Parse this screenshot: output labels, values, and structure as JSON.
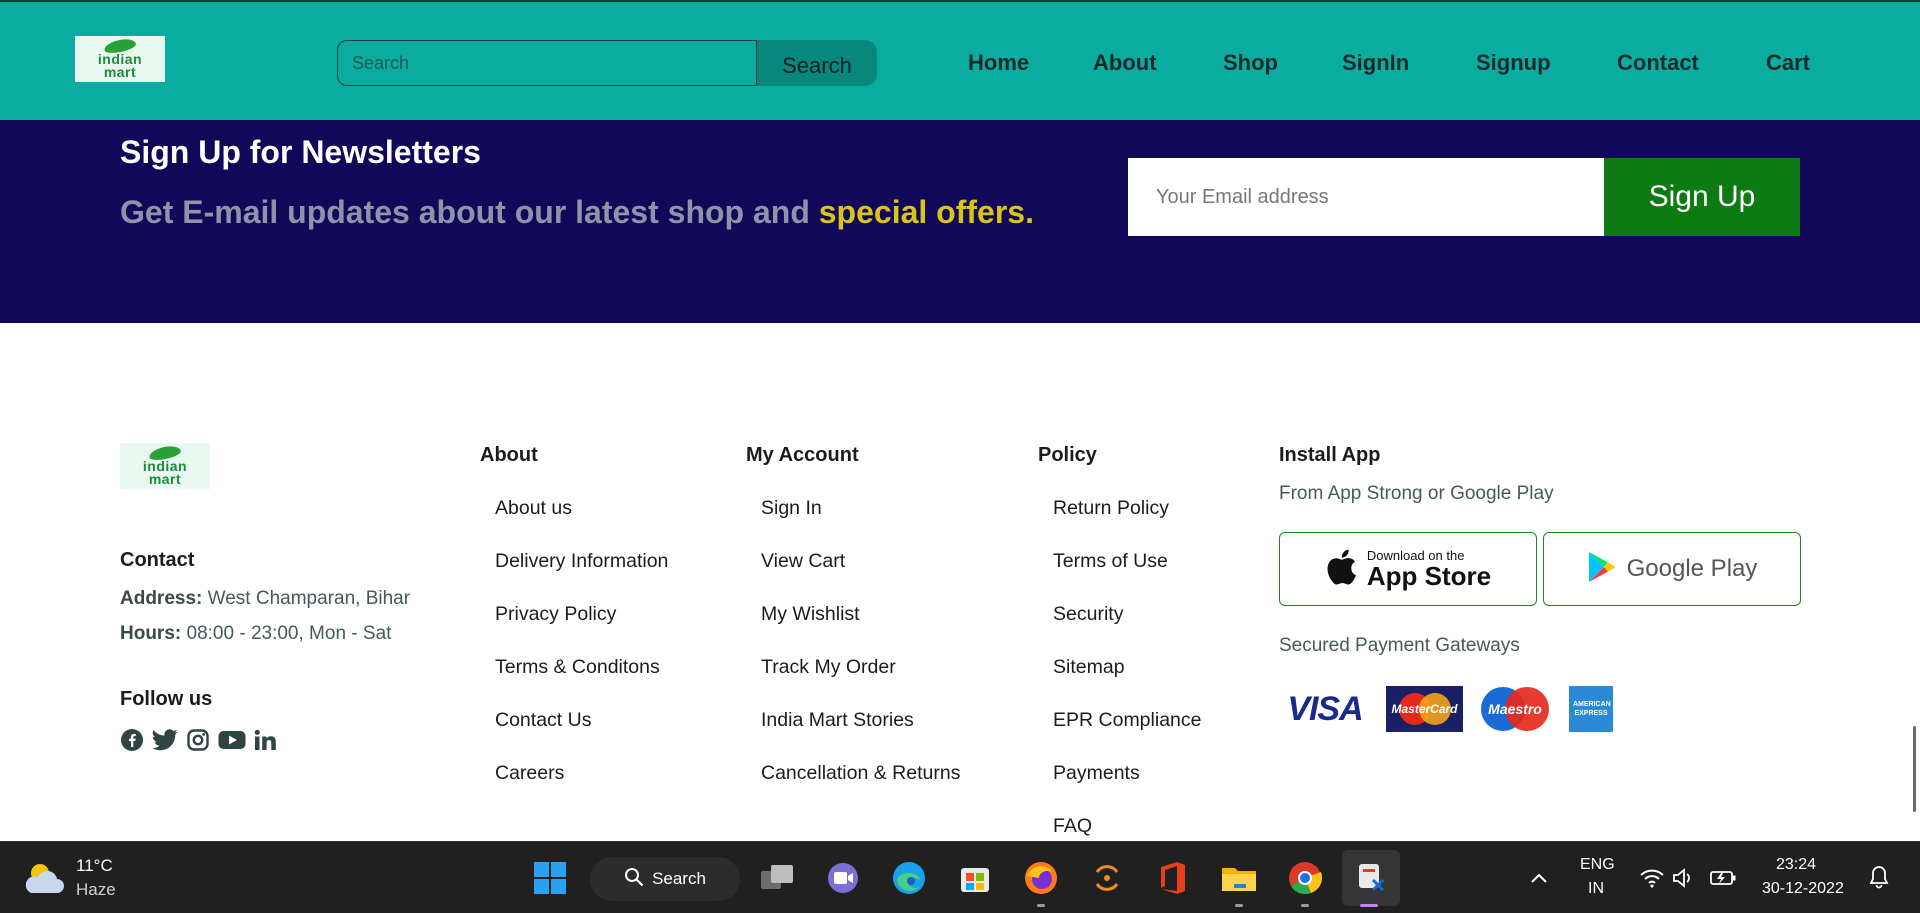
{
  "header": {
    "logo_lines": [
      "indian",
      "mart"
    ],
    "search_placeholder": "Search",
    "search_button": "Search",
    "nav": [
      "Home",
      "About",
      "Shop",
      "SignIn",
      "Signup",
      "Contact",
      "Cart"
    ]
  },
  "newsletter": {
    "title": "Sign Up for Newsletters",
    "subtitle_plain": "Get E-mail updates about our latest shop and",
    "subtitle_highlight": "special offers.",
    "email_placeholder": "Your Email address",
    "button": "Sign Up"
  },
  "footer": {
    "logo_lines": [
      "indian",
      "mart"
    ],
    "contact": {
      "heading": "Contact",
      "address_label": "Address:",
      "address_value": "West Champaran, Bihar",
      "hours_label": "Hours:",
      "hours_value": "08:00 - 23:00, Mon - Sat"
    },
    "follow": {
      "heading": "Follow us",
      "icons": [
        "facebook-icon",
        "twitter-icon",
        "instagram-icon",
        "youtube-icon",
        "linkedin-icon"
      ]
    },
    "about": {
      "heading": "About",
      "links": [
        "About us",
        "Delivery Information",
        "Privacy Policy",
        "Terms & Conditons",
        "Contact Us",
        "Careers"
      ]
    },
    "account": {
      "heading": "My Account",
      "links": [
        "Sign In",
        "View Cart",
        "My Wishlist",
        "Track My Order",
        "India Mart Stories",
        "Cancellation & Returns"
      ]
    },
    "policy": {
      "heading": "Policy",
      "links": [
        "Return Policy",
        "Terms of Use",
        "Security",
        "Sitemap",
        "EPR Compliance",
        "Payments",
        "FAQ"
      ]
    },
    "install": {
      "heading": "Install App",
      "subtitle": "From App Strong or Google Play",
      "appstore_small": "Download on the",
      "appstore_big": "App Store",
      "googleplay": "Google Play",
      "payments_label": "Secured Payment Gateways",
      "payment_methods": [
        "VISA",
        "MasterCard",
        "Maestro",
        "AMERICAN EXPRESS"
      ]
    }
  },
  "taskbar": {
    "weather_temp": "11°C",
    "weather_desc": "Haze",
    "search_label": "Search",
    "lang_top": "ENG",
    "lang_bottom": "IN",
    "time": "23:24",
    "date": "30-12-2022"
  },
  "colors": {
    "header_bg": "#0aaca0",
    "newsletter_bg": "#12085a",
    "highlight": "#d9c51a",
    "signup_btn": "#0e7a14",
    "taskbar_bg": "#202020"
  }
}
